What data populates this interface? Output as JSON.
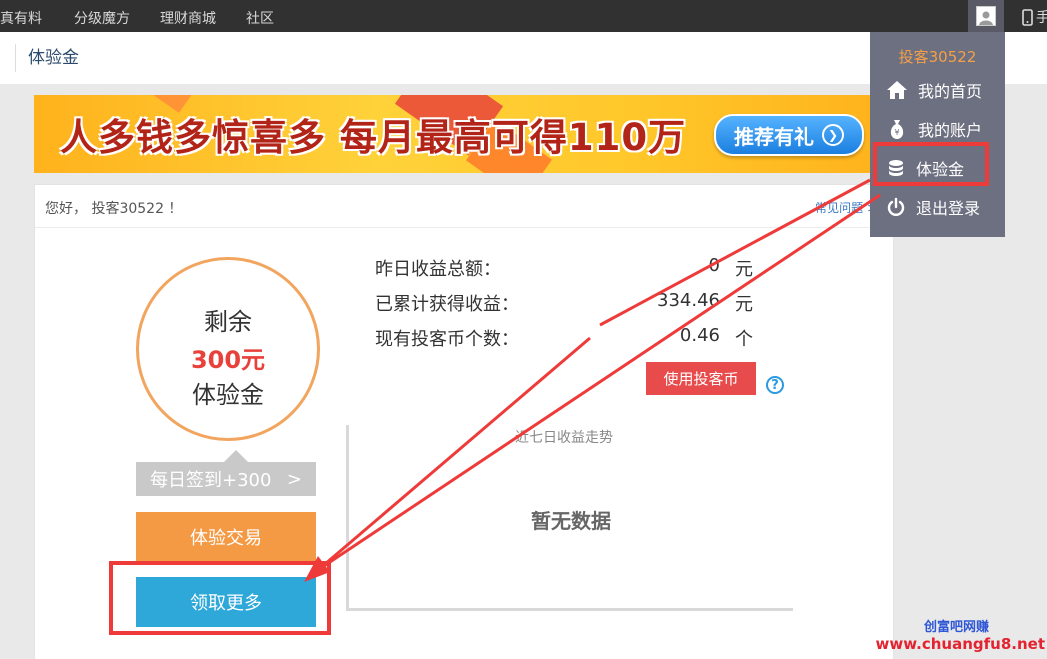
{
  "topnav": {
    "items": [
      "真有料",
      "分级魔方",
      "理财商城",
      "社区"
    ],
    "phone_label": "手"
  },
  "subheader": {
    "title": "体验金"
  },
  "banner": {
    "headline": "人多钱多惊喜多 每月最高可得110万",
    "cta_label": "推荐有礼",
    "cta_icon": "chevron-right-circle-icon",
    "colors": {
      "background": "#ffc72a",
      "headline": "#b22417",
      "cta": "#1b7fe0"
    }
  },
  "panel": {
    "greeting": "您好， 投客30522 ！",
    "faq_link": "常见问题 >",
    "balance": {
      "line1": "剩余",
      "amount": "300元",
      "line3": "体验金"
    },
    "checkin_label": "每日签到+300",
    "checkin_arrow": ">",
    "trade_button": "体验交易",
    "more_button": "领取更多",
    "stats": [
      {
        "label": "昨日收益总额：",
        "value": "0",
        "unit": "元"
      },
      {
        "label": "已累计获得收益：",
        "value": "334.46",
        "unit": "元"
      },
      {
        "label": "现有投客币个数：",
        "value": "0.46",
        "unit": "个"
      }
    ],
    "use_coin_button": "使用投客币",
    "help_glyph": "?",
    "chart": {
      "title": "近七日收益走势",
      "empty_text": "暂无数据"
    }
  },
  "dropdown": {
    "username": "投客30522",
    "items": [
      {
        "label": "我的首页",
        "icon": "home-icon"
      },
      {
        "label": "我的账户",
        "icon": "money-bag-icon"
      },
      {
        "label": "体验金",
        "icon": "coin-stack-icon"
      },
      {
        "label": "退出登录",
        "icon": "power-icon"
      }
    ]
  },
  "annotations": {
    "highlight_color": "#ef3a3a"
  },
  "watermark": {
    "line1": "创富吧网赚",
    "line2": "www.chuangfu8.net"
  }
}
